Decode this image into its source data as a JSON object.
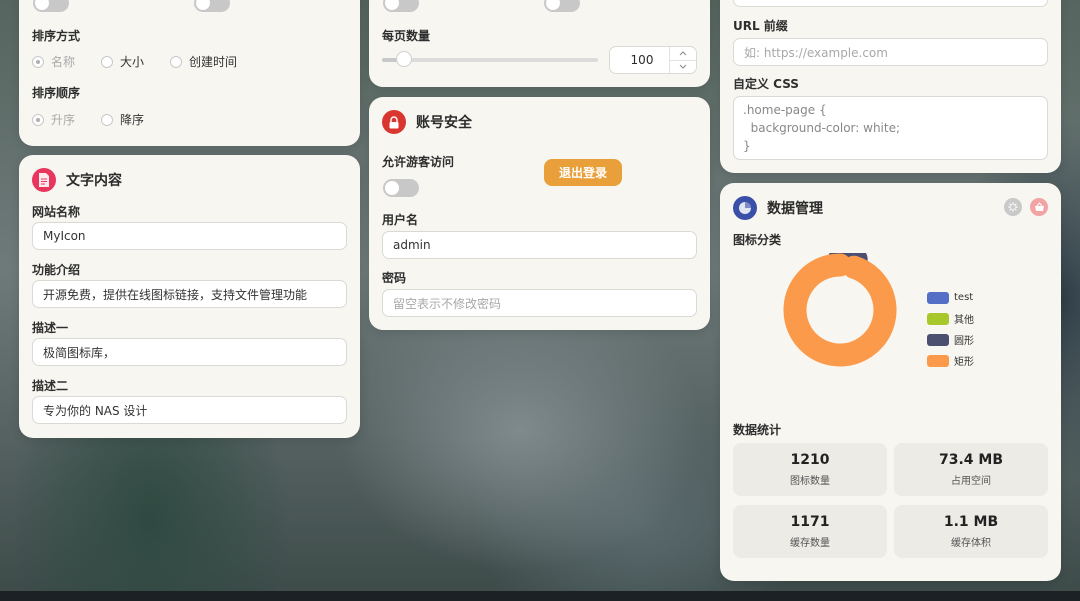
{
  "sort_card": {
    "sort_method_label": "排序方式",
    "sort_method_options": [
      "名称",
      "大小",
      "创建时间"
    ],
    "sort_order_label": "排序顺序",
    "sort_order_options": [
      "升序",
      "降序"
    ]
  },
  "text_card": {
    "title": "文字内容",
    "site_name_label": "网站名称",
    "site_name_value": "MyIcon",
    "intro_label": "功能介绍",
    "intro_value": "开源免费，提供在线图标链接，支持文件管理功能",
    "desc1_label": "描述一",
    "desc1_value": "极简图标库，",
    "desc2_label": "描述二",
    "desc2_value": "专为你的 NAS 设计"
  },
  "paging_card": {
    "per_page_label": "每页数量",
    "per_page_value": "100",
    "slider_fraction": 0.07
  },
  "security_card": {
    "title": "账号安全",
    "guest_label": "允许游客访问",
    "logout_label": "退出登录",
    "username_label": "用户名",
    "username_value": "admin",
    "password_label": "密码",
    "password_placeholder": "留空表示不修改密码"
  },
  "custom_card": {
    "url_prefix_label": "URL 前缀",
    "url_prefix_placeholder": "如: https://example.com",
    "css_label": "自定义 CSS",
    "css_lines": [
      ".home-page {",
      "  background-color: white;",
      "}"
    ]
  },
  "data_card": {
    "title": "数据管理",
    "category_label": "图标分类",
    "stats_label": "数据统计",
    "stats": [
      {
        "value": "1210",
        "label": "图标数量"
      },
      {
        "value": "73.4 MB",
        "label": "占用空间"
      },
      {
        "value": "1171",
        "label": "缓存数量"
      },
      {
        "value": "1.1 MB",
        "label": "缓存体积"
      }
    ]
  },
  "chart_data": {
    "type": "pie",
    "categories": [
      "test",
      "其他",
      "圆形",
      "矩形"
    ],
    "values": [
      0,
      0,
      5,
      95
    ],
    "colors": [
      "#5470c6",
      "#a8c72a",
      "#4b5070",
      "#fa9a4a"
    ],
    "legend": "right"
  },
  "colors": {
    "accent_orange": "#e9a03a",
    "card_bg": "#f7f6f1"
  }
}
